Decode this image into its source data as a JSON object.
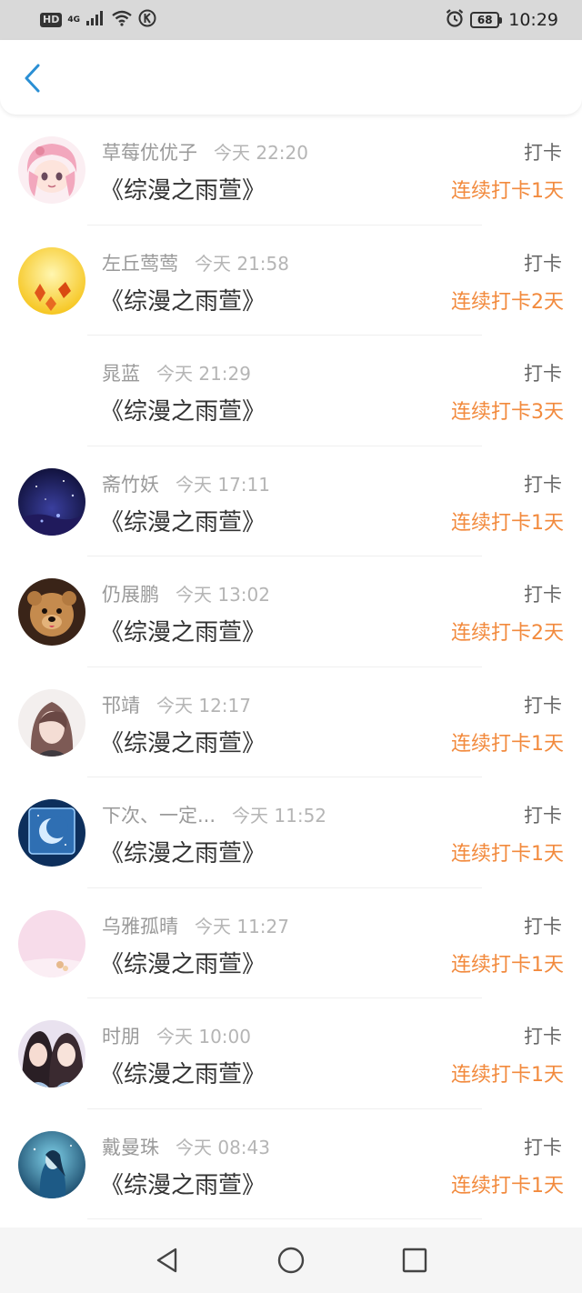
{
  "status_bar": {
    "hd": "HD",
    "network": "4G",
    "battery": "68",
    "time": "10:29",
    "icons": [
      "signal-icon",
      "wifi-icon",
      "k-app-icon",
      "alarm-icon",
      "battery-icon"
    ]
  },
  "header": {
    "back_icon": "chevron-left-icon",
    "accent_color": "#2a8fd4"
  },
  "colors": {
    "streak": "#f28a3d",
    "username": "#9a9a9a",
    "book": "#333333"
  },
  "records": [
    {
      "username": "草莓优优子",
      "time": "今天 22:20",
      "book": "《综漫之雨萱》",
      "action": "打卡",
      "streak": "连续打卡1天",
      "avatar": "anime-pink-hair-avatar"
    },
    {
      "username": "左丘莺莺",
      "time": "今天 21:58",
      "book": "《综漫之雨萱》",
      "action": "打卡",
      "streak": "连续打卡2天",
      "avatar": "yellow-autumn-leaves-avatar"
    },
    {
      "username": "晁蓝",
      "time": "今天 21:29",
      "book": "《综漫之雨萱》",
      "action": "打卡",
      "streak": "连续打卡3天",
      "avatar": ""
    },
    {
      "username": "斋竹妖",
      "time": "今天 17:11",
      "book": "《综漫之雨萱》",
      "action": "打卡",
      "streak": "连续打卡1天",
      "avatar": "night-sky-avatar"
    },
    {
      "username": "仍展鹏",
      "time": "今天 13:02",
      "book": "《综漫之雨萱》",
      "action": "打卡",
      "streak": "连续打卡2天",
      "avatar": "teddy-bear-avatar"
    },
    {
      "username": "邗靖",
      "time": "今天 12:17",
      "book": "《综漫之雨萱》",
      "action": "打卡",
      "streak": "连续打卡1天",
      "avatar": "anime-character-avatar"
    },
    {
      "username": "下次、一定...",
      "time": "今天 11:52",
      "book": "《综漫之雨萱》",
      "action": "打卡",
      "streak": "连续打卡1天",
      "avatar": "moon-window-avatar"
    },
    {
      "username": "乌雅孤晴",
      "time": "今天 11:27",
      "book": "《综漫之雨萱》",
      "action": "打卡",
      "streak": "连续打卡1天",
      "avatar": "pink-pastel-avatar"
    },
    {
      "username": "时朋",
      "time": "今天 10:00",
      "book": "《综漫之雨萱》",
      "action": "打卡",
      "streak": "连续打卡1天",
      "avatar": "two-girls-photo-avatar"
    },
    {
      "username": "戴曼珠",
      "time": "今天 08:43",
      "book": "《综漫之雨萱》",
      "action": "打卡",
      "streak": "连续打卡1天",
      "avatar": "blue-fantasy-avatar"
    }
  ],
  "nav_bar": {
    "icons": [
      "back-triangle-icon",
      "home-circle-icon",
      "recents-square-icon"
    ]
  }
}
